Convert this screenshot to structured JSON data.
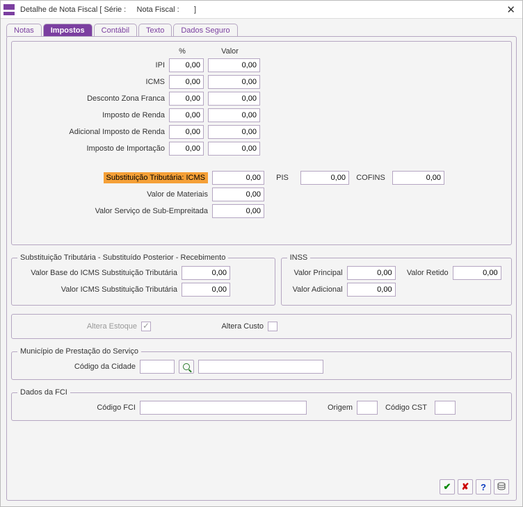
{
  "window": {
    "title": "Detalhe de Nota Fiscal [ Série :     Nota Fiscal :       ]"
  },
  "tabs": {
    "notas": "Notas",
    "impostos": "Impostos",
    "contabil": "Contábil",
    "texto": "Texto",
    "dados_seguro": "Dados Seguro"
  },
  "headers": {
    "pct": "%",
    "valor": "Valor"
  },
  "tax_rows": {
    "ipi": {
      "label": "IPI",
      "pct": "0,00",
      "valor": "0,00"
    },
    "icms": {
      "label": "ICMS",
      "pct": "0,00",
      "valor": "0,00"
    },
    "desc_zf": {
      "label": "Desconto Zona Franca",
      "pct": "0,00",
      "valor": "0,00"
    },
    "ir": {
      "label": "Imposto de Renda",
      "pct": "0,00",
      "valor": "0,00"
    },
    "adic_ir": {
      "label": "Adicional Imposto de Renda",
      "pct": "0,00",
      "valor": "0,00"
    },
    "ii": {
      "label": "Imposto de Importação",
      "pct": "0,00",
      "valor": "0,00"
    }
  },
  "st_line": {
    "label": "Substituição Tributária: ICMS",
    "valor": "0,00",
    "pis_label": "PIS",
    "pis_valor": "0,00",
    "cofins_label": "COFINS",
    "cofins_valor": "0,00"
  },
  "valor_materiais": {
    "label": "Valor de Materiais",
    "valor": "0,00"
  },
  "valor_servico": {
    "label": "Valor Serviço de Sub-Empreitada",
    "valor": "0,00"
  },
  "st_post": {
    "legend": "Substituição Tributária - Substituído Posterior - Recebimento",
    "base_label": "Valor Base do ICMS Substituição Tributária",
    "base_valor": "0,00",
    "icms_label": "Valor ICMS Substituição Tributária",
    "icms_valor": "0,00"
  },
  "inss": {
    "legend": "INSS",
    "principal_label": "Valor Principal",
    "principal_valor": "0,00",
    "retido_label": "Valor Retido",
    "retido_valor": "0,00",
    "adicional_label": "Valor Adicional",
    "adicional_valor": "0,00"
  },
  "flags": {
    "altera_estoque_label": "Altera Estoque",
    "altera_custo_label": "Altera Custo"
  },
  "municipio": {
    "legend": "Município de Prestação do Serviço",
    "codigo_label": "Código da Cidade",
    "codigo_valor": "",
    "nome_valor": ""
  },
  "fci": {
    "legend": "Dados da FCI",
    "codigo_label": "Código FCI",
    "codigo_valor": "",
    "origem_label": "Origem",
    "origem_valor": "",
    "cst_label": "Código CST",
    "cst_valor": ""
  }
}
